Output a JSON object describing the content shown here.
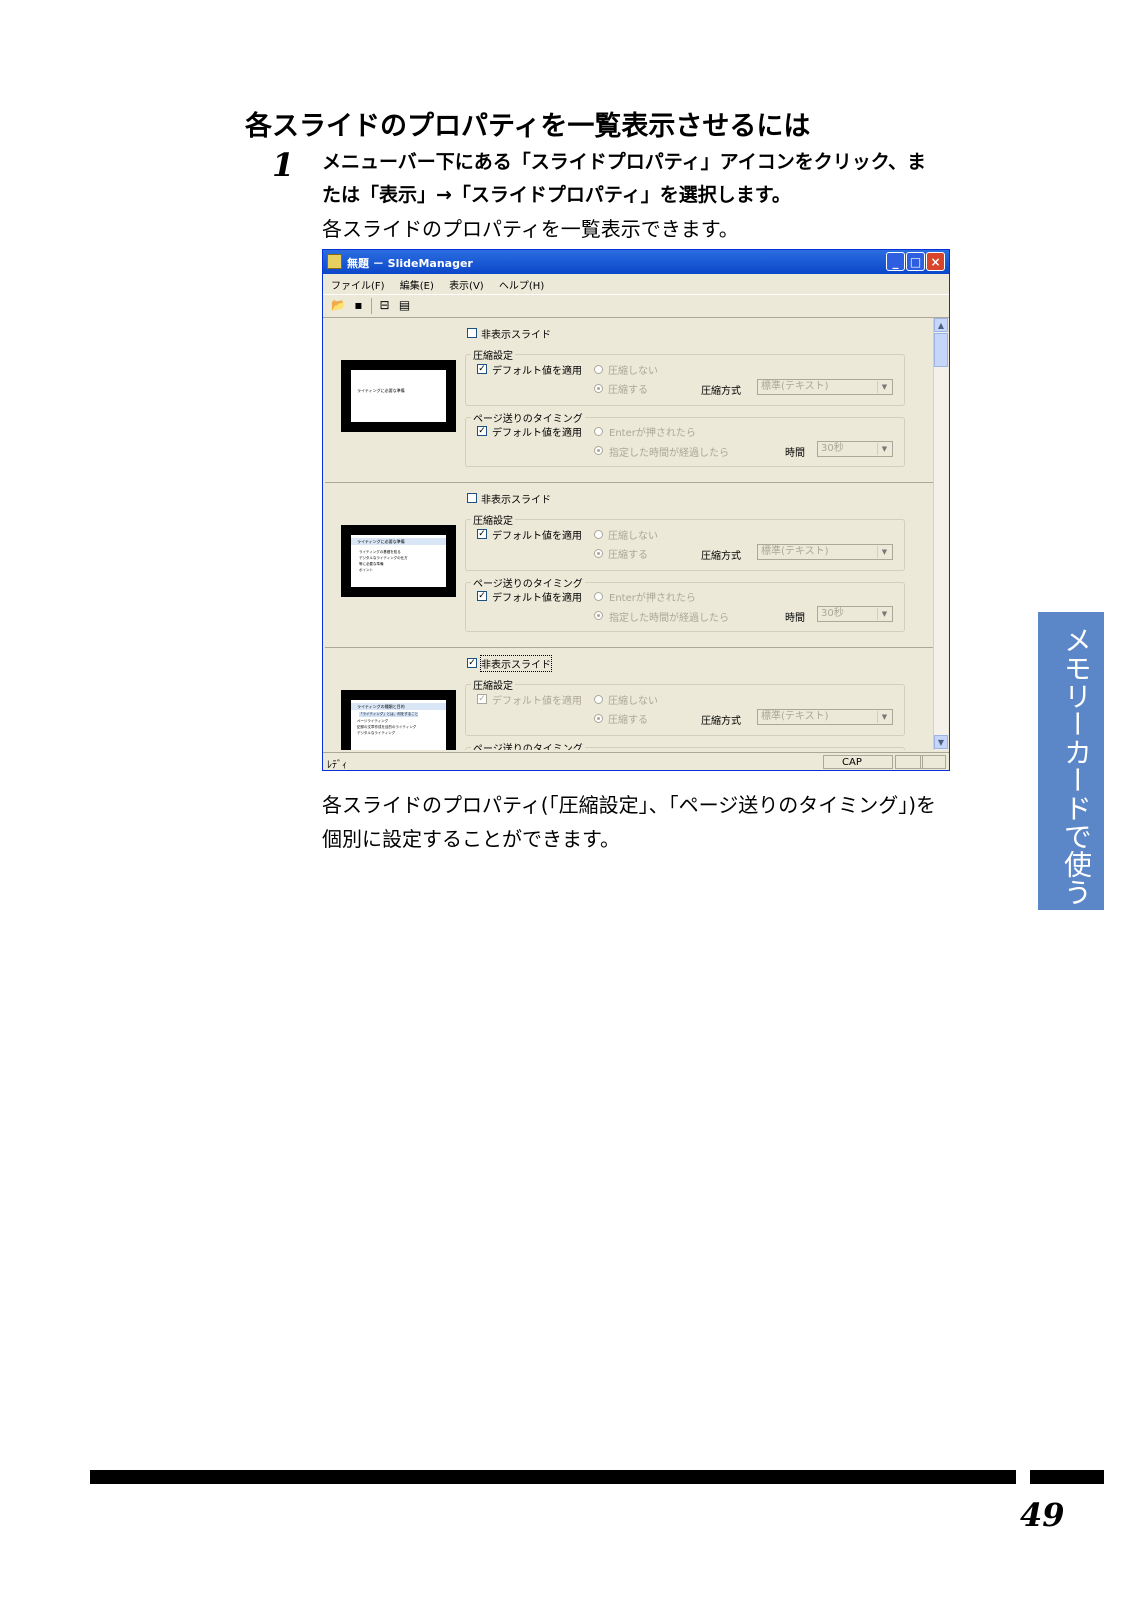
{
  "heading": "各スライドのプロパティを一覧表示させるには",
  "step": {
    "number": "1",
    "line1": "メニューバー下にある「スライドプロパティ」アイコンをクリック、ま",
    "line2": "たは「表示」→「スライドプロパティ」を選択します。",
    "result": "各スライドのプロパティを一覧表示できます。"
  },
  "window": {
    "title": "無題 － SlideManager",
    "menu": [
      "ファイル(F)",
      "編集(E)",
      "表示(V)",
      "ヘルプ(H)"
    ],
    "toolbar_icons": [
      "open-icon",
      "save-icon",
      "slide-list-icon",
      "slide-property-icon"
    ],
    "rows": [
      {
        "hidden_label": "非表示スライド",
        "hidden_checked": false,
        "thumb_title": "ライティングに必要な準備",
        "thumb_bullets": [],
        "compress_group": "圧縮設定",
        "compress_default": "デフォルト値を適用",
        "compress_no": "圧縮しない",
        "compress_yes": "圧縮する",
        "compress_method_label": "圧縮方式",
        "compress_method_value": "標準(テキスト)",
        "timing_group": "ページ送りのタイミング",
        "timing_default": "デフォルト値を適用",
        "timing_enter": "Enterが押されたら",
        "timing_time": "指定した時間が経過したら",
        "time_label": "時間",
        "time_value": "30秒"
      },
      {
        "hidden_label": "非表示スライド",
        "hidden_checked": false,
        "thumb_title": "ライティングに必要な準備",
        "thumb_bullets": [
          "ライティングの基礎を知る",
          "デジタルなライティングの仕方",
          "等に必要な準備",
          "ポイント"
        ],
        "compress_group": "圧縮設定",
        "compress_default": "デフォルト値を適用",
        "compress_no": "圧縮しない",
        "compress_yes": "圧縮する",
        "compress_method_label": "圧縮方式",
        "compress_method_value": "標準(テキスト)",
        "timing_group": "ページ送りのタイミング",
        "timing_default": "デフォルト値を適用",
        "timing_enter": "Enterが押されたら",
        "timing_time": "指定した時間が経過したら",
        "time_label": "時間",
        "time_value": "30秒"
      },
      {
        "hidden_label": "非表示スライド",
        "hidden_checked": true,
        "thumb_title": "ライティングの種類と目的",
        "thumb_bullets": [
          "「ライティング」とは、何をすること",
          "ページライティング",
          "記録の文章作成を目的のライティング",
          "デジタルなライティング"
        ],
        "compress_group": "圧縮設定",
        "compress_default": "デフォルト値を適用",
        "compress_no": "圧縮しない",
        "compress_yes": "圧縮する",
        "compress_method_label": "圧縮方式",
        "compress_method_value": "標準(テキスト)",
        "timing_group": "ページ送りのタイミング"
      }
    ],
    "status_ready": "ﾚﾃﾞｨ",
    "status_cap": "CAP"
  },
  "caption": {
    "line1": "各スライドのプロパティ(「圧縮設定」、「ページ送りのタイミング」)を",
    "line2": "個別に設定することができます。"
  },
  "side_tab": "メモリーカードで使う",
  "page_number": "49",
  "colors": {
    "side_tab": "#5b86c8",
    "title_bar": "#0b47c9",
    "window_bg": "#ece9d8"
  }
}
